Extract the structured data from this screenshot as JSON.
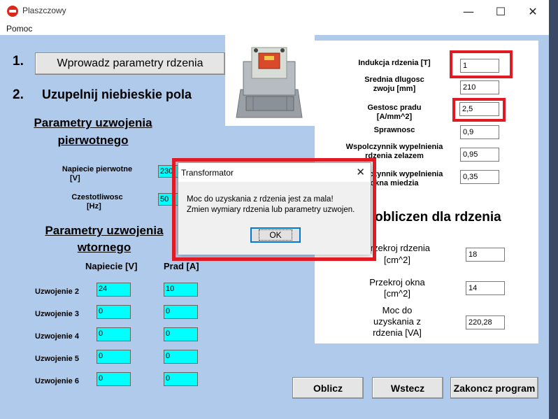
{
  "window": {
    "title": "Plaszczowy",
    "minimize_glyph": "—",
    "maximize_glyph": "☐",
    "close_glyph": "✕"
  },
  "menu": {
    "items": [
      "Pomoc"
    ]
  },
  "steps": {
    "step1_number": "1.",
    "step1_button": "Wprowadz parametry rdzenia",
    "step2_number": "2.",
    "step2_text": "Uzupelnij niebieskie pola"
  },
  "primary": {
    "title_line1": "Parametry uzwojenia",
    "title_line2": "pierwotnego",
    "voltage_label_line1": "Napiecie pierwotne",
    "voltage_label_line2": "[V]",
    "voltage_value": "230",
    "freq_label_line1": "Czestotliwosc",
    "freq_label_line2": "[Hz]",
    "freq_value": "50"
  },
  "secondary": {
    "title_line1": "Parametry uzwojenia",
    "title_line2": "wtornego",
    "col_voltage": "Napiecie [V]",
    "col_current": "Prad [A]",
    "rows": [
      {
        "label": "Uzwojenie 2",
        "voltage": "24",
        "current": "10"
      },
      {
        "label": "Uzwojenie 3",
        "voltage": "0",
        "current": "0"
      },
      {
        "label": "Uzwojenie 4",
        "voltage": "0",
        "current": "0"
      },
      {
        "label": "Uzwojenie 5",
        "voltage": "0",
        "current": "0"
      },
      {
        "label": "Uzwojenie 6",
        "voltage": "0",
        "current": "0"
      }
    ]
  },
  "core": {
    "induction_label": "Indukcja rdzenia [T]",
    "induction_value": "1",
    "avg_length_label_line1": "Srednia dlugosc",
    "avg_length_label_line2": "zwoju [mm]",
    "avg_length_value": "210",
    "current_density_label_line1": "Gestosc pradu",
    "current_density_label_line2": "[A/mm^2]",
    "current_density_value": "2,5",
    "efficiency_label": "Sprawnosc",
    "efficiency_value": "0,9",
    "iron_fill_label_line1": "Wspolczynnik wypelnienia",
    "iron_fill_label_line2": "rdzenia zelazem",
    "iron_fill_value": "0,95",
    "copper_fill_label_line1": "Wspolczynnik wypelnienia",
    "copper_fill_label_line2": "okna miedzia",
    "copper_fill_value": "0,35"
  },
  "results": {
    "title": "Wyniki obliczen dla rdzenia",
    "core_section_line1": "Przekroj rdzenia",
    "core_section_line2": "[cm^2]",
    "core_section_value": "18",
    "window_section_line1": "Przekroj okna",
    "window_section_line2": "[cm^2]",
    "window_section_value": "14",
    "power_line1": "Moc do",
    "power_line2": "uzyskania z",
    "power_line3": "rdzenia [VA]",
    "power_value": "220,28"
  },
  "buttons": {
    "calculate": "Oblicz",
    "back": "Wstecz",
    "exit": "Zakoncz program"
  },
  "dialog": {
    "title": "Transformator",
    "message": "Moc do uzyskania z rdzenia jest za mala!\nZmien wymiary rdzenia lub parametry uzwojen.",
    "ok": "OK"
  },
  "colors": {
    "client_bg": "#afcaeb",
    "input_cyan": "#00ffff",
    "highlight_red": "#e01b24"
  }
}
